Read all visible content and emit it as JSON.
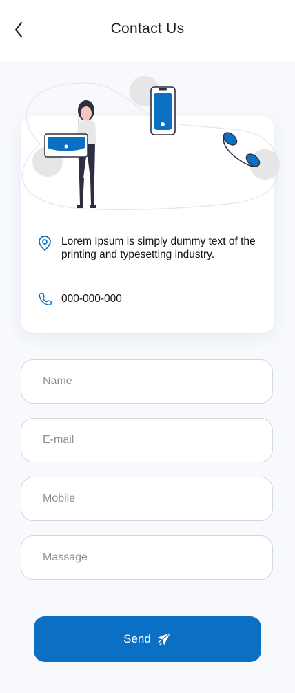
{
  "header": {
    "title": "Contact Us",
    "back_icon": "chevron-left-icon"
  },
  "contact": {
    "address": "Lorem Ipsum is simply dummy text of the printing and typesetting industry.",
    "address_icon": "location-pin-icon",
    "phone": "000-000-000",
    "phone_icon": "phone-icon"
  },
  "form": {
    "name_placeholder": "Name",
    "email_placeholder": "E-mail",
    "mobile_placeholder": "Mobile",
    "message_placeholder": "Massage",
    "send_label": "Send",
    "send_icon": "paper-plane-icon"
  },
  "colors": {
    "accent": "#0b6fc4",
    "background": "#f7f9fc",
    "field_border": "#d4d7de"
  }
}
